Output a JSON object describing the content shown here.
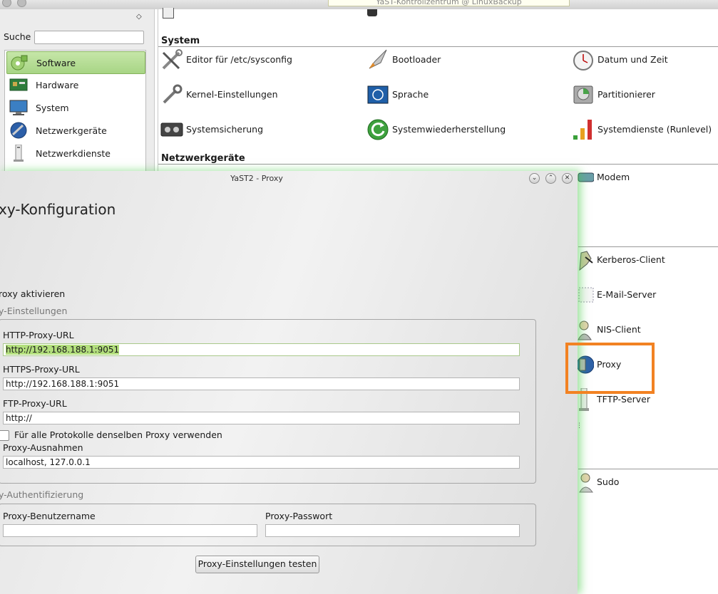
{
  "background_window": {
    "title": "YaST-Kontrollzentrum @ LinuxBackup",
    "search_label": "Suche",
    "search_value": "",
    "categories": [
      {
        "label": "Software",
        "icon": "software-icon",
        "selected": true
      },
      {
        "label": "Hardware",
        "icon": "hardware-icon"
      },
      {
        "label": "System",
        "icon": "system-icon"
      },
      {
        "label": "Netzwerkgeräte",
        "icon": "network-devices-icon"
      },
      {
        "label": "Netzwerkdienste",
        "icon": "network-services-icon"
      }
    ],
    "sections": {
      "system": "System",
      "network_devices": "Netzwerkgeräte"
    },
    "system_modules": [
      "Editor für /etc/sysconfig",
      "Bootloader",
      "Datum und Zeit",
      "Kernel-Einstellungen",
      "Sprache",
      "Partitionierer",
      "Systemsicherung",
      "Systemwiederherstellung",
      "Systemdienste (Runlevel)"
    ],
    "network_modules_visible": [
      "Modem",
      "Kerberos-Client",
      "E-Mail-Server",
      "NIS-Client",
      "Proxy",
      "TFTP-Server",
      "Sudo"
    ],
    "highlight_color": "#f28222"
  },
  "dialog": {
    "title": "YaST2 - Proxy",
    "heading": "xy-Konfiguration",
    "enable_label": "roxy aktivieren",
    "settings_group_title": "y-Einstellungen",
    "http_label": "HTTP-Proxy-URL",
    "http_value": "http://192.168.188.1:9051",
    "https_label": "HTTPS-Proxy-URL",
    "https_value": "http://192.168.188.1:9051",
    "ftp_label": "FTP-Proxy-URL",
    "ftp_value": "http://",
    "same_proxy_label": "Für alle Protokolle denselben Proxy verwenden",
    "same_proxy_checked": false,
    "exceptions_label": "Proxy-Ausnahmen",
    "exceptions_value": "localhost, 127.0.0.1",
    "auth_group_title": "y-Authentifizierung",
    "username_label": "Proxy-Benutzername",
    "username_value": "",
    "password_label": "Proxy-Passwort",
    "password_value": "",
    "test_button": "Proxy-Einstellungen testen"
  }
}
